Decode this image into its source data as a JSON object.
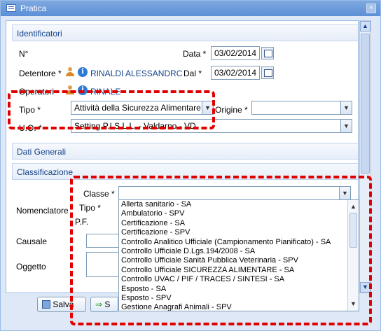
{
  "window": {
    "title": "Pratica",
    "close_label": "×"
  },
  "identificatori": {
    "header": "Identificatori",
    "n_label": "N°",
    "data_label": "Data *",
    "data_value": "03/02/2014",
    "detentore_label": "Detentore *",
    "detentore_value": "RINALDI ALESSANDRC",
    "dal_label": "Dal *",
    "dal_value": "03/02/2014",
    "operatori_label": "Operatori",
    "operatori_value": "RINALE",
    "tipo_label": "Tipo *",
    "tipo_value": "Attività della Sicurezza Alimentare",
    "origine_label": "Origine *",
    "origine_value": "",
    "uo_label": "U.O. *",
    "uo_value": "Setting  P.I.S.L.L. - Valdarno - VD"
  },
  "dati_generali": {
    "header": "Dati Generali"
  },
  "classificazione": {
    "header": "Classificazione",
    "nomenclatore_label": "Nomenclatore",
    "classe_label": "Classe *",
    "classe_value": "",
    "tipo_label": "Tipo *",
    "pf_label": "P.F.",
    "causale_label": "Causale",
    "oggetto_label": "Oggetto"
  },
  "classe_options": [
    "Allerta sanitario - SA",
    "Ambulatorio - SPV",
    "Certificazione - SA",
    "Certificazione - SPV",
    "Controllo Analitico Ufficiale (Campionamento Pianificato) - SA",
    "Controllo Ufficiale D.Lgs.194/2008 - SA",
    "Controllo Ufficiale Sanità Pubblica Veterinaria - SPV",
    "Controllo Ufficiale SICUREZZA ALIMENTARE - SA",
    "Controllo UVAC / PIF / TRACES / SINTESI - SA",
    "Esposto - SA",
    "Esposto - SPV",
    "Gestione Anagrafi Animali - SPV"
  ],
  "footer": {
    "save_label": "Salva",
    "second_label": "S"
  },
  "icons": {
    "person": "user-icon",
    "info": "info-icon",
    "calendar": "calendar-icon",
    "dropdown": "chevron-down-icon"
  },
  "colors": {
    "accent": "#15428b",
    "highlight": "#e00000",
    "title_bar": "#5b8fd6"
  }
}
